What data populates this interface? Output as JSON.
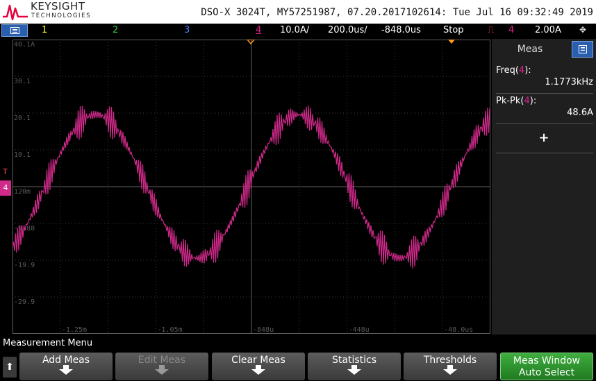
{
  "brand": {
    "name": "KEYSIGHT",
    "sub": "TECHNOLOGIES",
    "logo_color": "#e4003b"
  },
  "header": {
    "info": "DSO-X 3024T, MY57251987, 07.20.2017102614: Tue Jul 16 09:32:49 2019"
  },
  "status": {
    "ch1": "1",
    "ch2": "2",
    "ch3": "3",
    "ch4": "4",
    "vscale": "10.0A/",
    "tscale": "200.0us/",
    "delay": "-848.0us",
    "run_state": "Stop",
    "trig_ch": "4",
    "trig_level": "2.00A",
    "colors": {
      "ch1": "#ffff00",
      "ch2": "#33cc33",
      "ch3": "#4d7fff",
      "ch4": "#e02090",
      "trig": "#ff3030"
    }
  },
  "grid": {
    "ylabels": [
      "40.1A",
      "30.1",
      "20.1",
      "10.1",
      "120m",
      "-9.88",
      "-19.9",
      "-29.9"
    ],
    "xlabels": [
      "-1.25m",
      "-1.05m",
      "-848u",
      "-448u",
      "-48.0us"
    ]
  },
  "measurements": {
    "title": "Meas",
    "items": [
      {
        "name": "Freq(",
        "ch": "4",
        "close": "):",
        "value": "1.1773kHz"
      },
      {
        "name": "Pk-Pk(",
        "ch": "4",
        "close": "):",
        "value": "48.6A"
      }
    ],
    "add": "+"
  },
  "softkeys": {
    "menu_label": "Measurement Menu",
    "back": "⬆",
    "keys": [
      {
        "label": "Add Meas",
        "enabled": true
      },
      {
        "label": "Edit Meas",
        "enabled": false
      },
      {
        "label": "Clear Meas",
        "enabled": true
      },
      {
        "label": "Statistics",
        "enabled": true
      },
      {
        "label": "Thresholds",
        "enabled": true
      },
      {
        "label": "Meas Window",
        "label2": "Auto Select",
        "enabled": true
      }
    ]
  },
  "waveform": {
    "channel": "4",
    "color": "#d02a8a",
    "time_per_div_us": 200,
    "frequency_khz": 1.1773,
    "amplitude_a": 19.5,
    "offset_a": 0.1,
    "ripple_a": 4.5,
    "trigger_marker_color": "#ff9a20"
  }
}
